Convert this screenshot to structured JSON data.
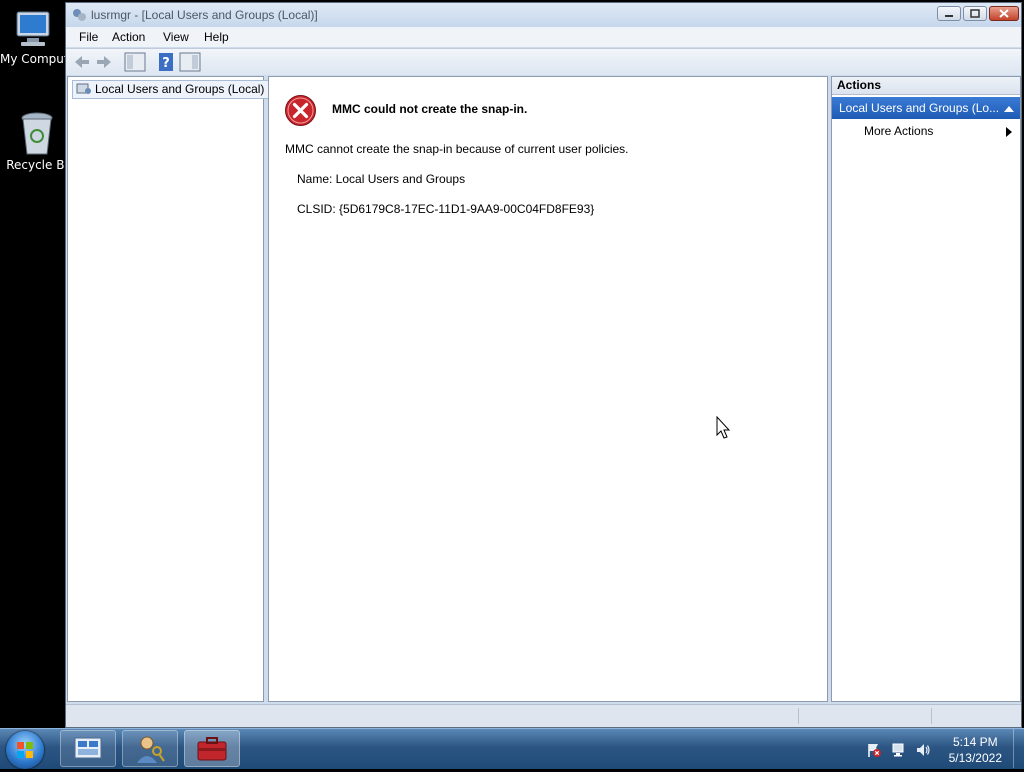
{
  "desktop": {
    "icons": [
      {
        "label": "My Comput",
        "icon": "computer-icon"
      },
      {
        "label": "Recycle Bi",
        "icon": "recycle-bin-icon"
      }
    ]
  },
  "window": {
    "title": "lusrmgr - [Local Users and Groups (Local)]",
    "menu": [
      "File",
      "Action",
      "View",
      "Help"
    ]
  },
  "tree": {
    "root_label": "Local Users and Groups (Local)"
  },
  "error": {
    "title": "MMC could not create the snap-in.",
    "message": "MMC cannot create the snap-in because of current user policies.",
    "name_line": "Name: Local Users and Groups",
    "clsid_line": "CLSID: {5D6179C8-17EC-11D1-9AA9-00C04FD8FE93}"
  },
  "actions": {
    "header": "Actions",
    "group_label": "Local Users and Groups (Lo...",
    "more_actions": "More Actions"
  },
  "taskbar": {
    "time": "5:14 PM",
    "date": "5/13/2022"
  },
  "colors": {
    "accent": "#1f5bb5",
    "error_red": "#c8262c"
  }
}
